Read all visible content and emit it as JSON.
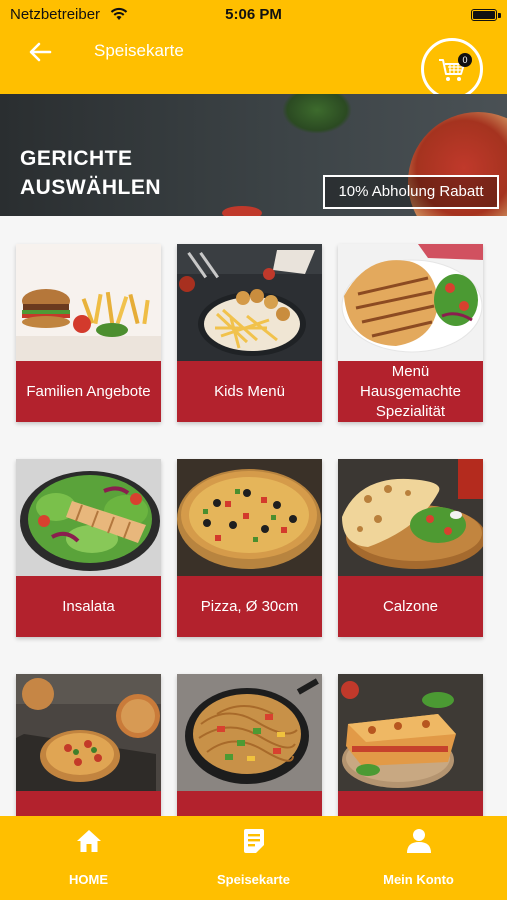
{
  "status_bar": {
    "carrier": "Netzbetreiber",
    "time": "5:06 PM"
  },
  "header": {
    "title": "Speisekarte",
    "cart_count": "0"
  },
  "banner": {
    "heading_line1": "GERICHTE",
    "heading_line2": "AUSWÄHLEN",
    "promo": "10% Abholung Rabatt"
  },
  "categories": [
    {
      "label": "Familien Angebote"
    },
    {
      "label": "Kids Menü"
    },
    {
      "label": "Menü Hausgemachte Spezialität"
    },
    {
      "label": "Insalata"
    },
    {
      "label": "Pizza, Ø 30cm"
    },
    {
      "label": "Calzone"
    },
    {
      "label": ""
    },
    {
      "label": ""
    },
    {
      "label": ""
    }
  ],
  "bottom_nav": [
    {
      "label": "HOME",
      "icon": "home-icon"
    },
    {
      "label": "Speisekarte",
      "icon": "menu-document-icon"
    },
    {
      "label": "Mein Konto",
      "icon": "user-icon"
    }
  ],
  "colors": {
    "accent": "#ffbf00",
    "card_label": "#b3222d"
  }
}
